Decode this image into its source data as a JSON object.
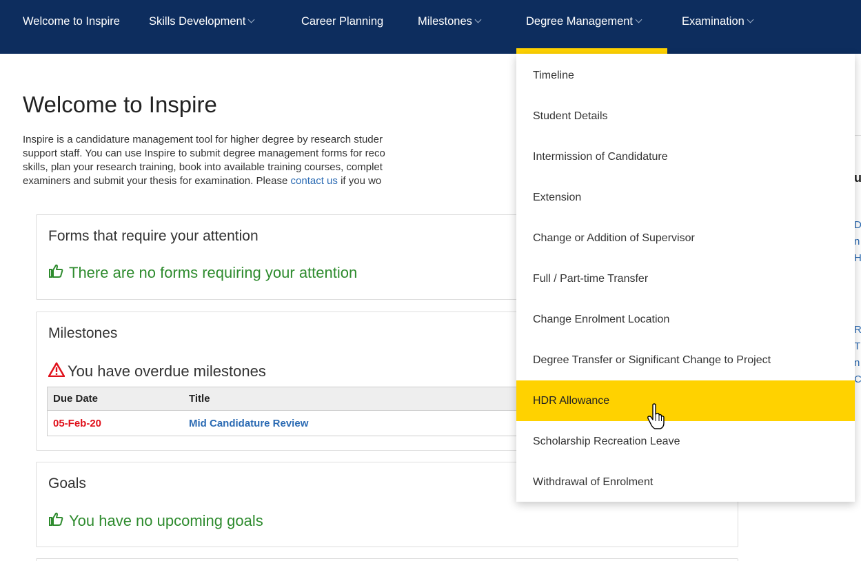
{
  "nav": {
    "items": [
      {
        "label": "Welcome to Inspire",
        "has_chevron": false
      },
      {
        "label": "Skills Development",
        "has_chevron": true
      },
      {
        "label": "Career Planning",
        "has_chevron": false
      },
      {
        "label": "Milestones",
        "has_chevron": true
      },
      {
        "label": "Degree Management",
        "has_chevron": true
      },
      {
        "label": "Examination",
        "has_chevron": true
      }
    ],
    "active_item": "Degree Management",
    "colors": {
      "bar": "#0d2d5e",
      "accent": "#ffd200"
    }
  },
  "main": {
    "title": "Welcome to Inspire",
    "intro_lines": [
      "Inspire is a candidature management tool for higher degree by research studer",
      "support staff. You can use Inspire to submit degree management forms for reco",
      "skills, plan your research training, book into available training courses, complet",
      "examiners and submit your thesis for examination. Please "
    ],
    "intro_link": "contact us",
    "intro_tail": " if you wo"
  },
  "forms_panel": {
    "title": "Forms that require your attention",
    "message": "There are no forms requiring your attention",
    "icon": "thumbs-up-icon"
  },
  "milestones_panel": {
    "title": "Milestones",
    "warning": "You have overdue milestones",
    "icon": "warning-icon",
    "columns": [
      "Due Date",
      "Title"
    ],
    "rows": [
      {
        "due_date": "05-Feb-20",
        "title": "Mid Candidature Review",
        "due_color": "#e0101a",
        "title_color": "#2a6ab3"
      }
    ]
  },
  "goals_panel": {
    "title": "Goals",
    "message": "You have no upcoming goals",
    "icon": "thumbs-up-icon"
  },
  "sidebar_fragments": [
    "u",
    "D",
    "n",
    "H",
    "R",
    "T",
    "n",
    "C"
  ],
  "dropdown": {
    "items": [
      "Timeline",
      "Student Details",
      "Intermission of Candidature",
      "Extension",
      "Change or Addition of Supervisor",
      "Full / Part-time Transfer",
      "Change Enrolment Location",
      "Degree Transfer or Significant Change to Project",
      "HDR Allowance",
      "Scholarship Recreation Leave",
      "Withdrawal of Enrolment"
    ],
    "highlighted": "HDR Allowance"
  }
}
